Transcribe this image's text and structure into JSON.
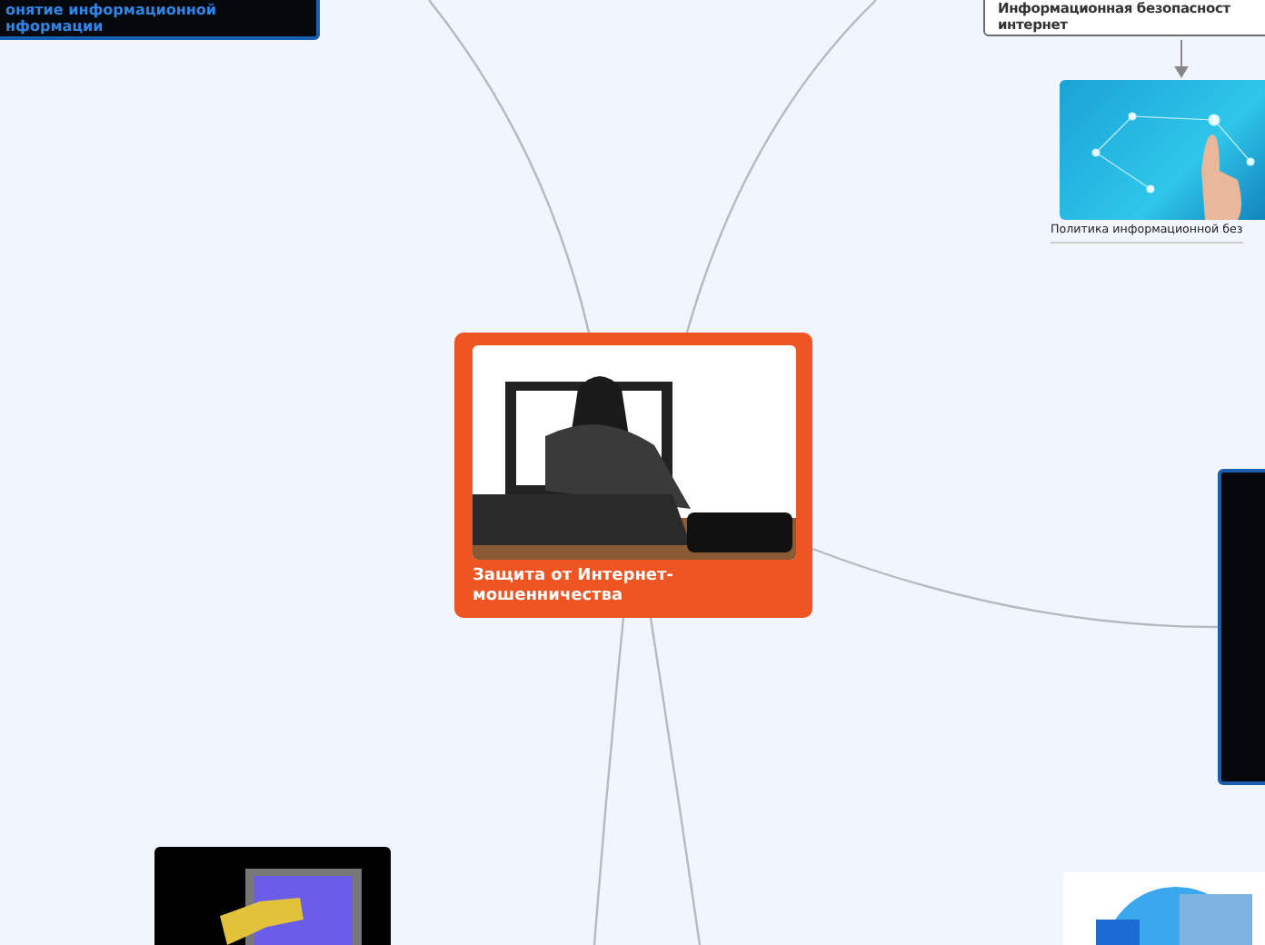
{
  "nodes": [
    {
      "kind": "dark-text",
      "lines": [
        "онятие информационной",
        "нформации"
      ]
    },
    {
      "kind": "light-text",
      "lines": [
        "Информационная безопасност",
        "интернет"
      ]
    },
    {
      "kind": "image-caption",
      "caption": "Политика информационной без"
    },
    {
      "kind": "central",
      "title": "Защита от Интернет-мошенничества"
    },
    {
      "kind": "dark-image"
    },
    {
      "kind": "key-image"
    },
    {
      "kind": "globe-image"
    }
  ]
}
